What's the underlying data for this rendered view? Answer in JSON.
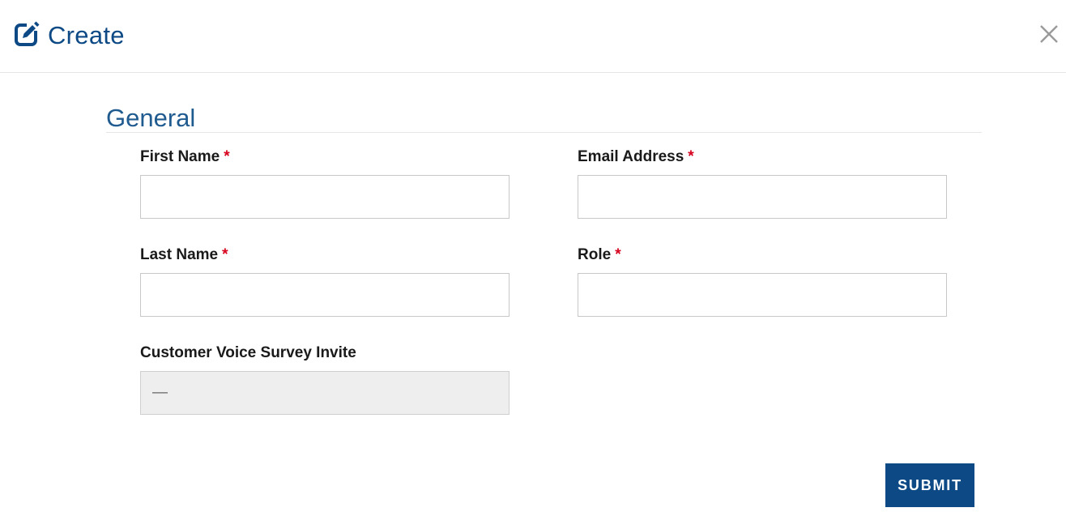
{
  "header": {
    "title": "Create",
    "icon": "edit-icon",
    "close_icon": "close-icon",
    "accent_color": "#0d4a85"
  },
  "section": {
    "title": "General"
  },
  "fields": {
    "first_name": {
      "label": "First Name",
      "required_mark": "*",
      "value": ""
    },
    "email": {
      "label": "Email Address",
      "required_mark": "*",
      "value": ""
    },
    "last_name": {
      "label": "Last Name",
      "required_mark": "*",
      "value": ""
    },
    "role": {
      "label": "Role",
      "required_mark": "*",
      "value": ""
    },
    "survey_invite": {
      "label": "Customer Voice Survey Invite",
      "value": "—"
    }
  },
  "actions": {
    "submit_label": "SUBMIT"
  },
  "colors": {
    "required": "#d6001c",
    "button": "#0d4a85"
  }
}
